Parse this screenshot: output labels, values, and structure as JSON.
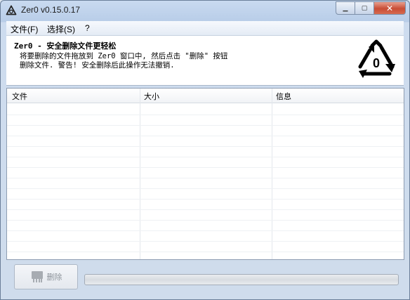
{
  "window": {
    "title": "Zer0 v0.15.0.17",
    "controls": {
      "minimize": "▁",
      "maximize": "▢",
      "close": "✕"
    }
  },
  "menu": [
    {
      "label": "文件(F)"
    },
    {
      "label": "选择(S)"
    },
    {
      "label": "?"
    }
  ],
  "header": {
    "title": "Zer0 - 安全删除文件更轻松",
    "description_line1": "将要删除的文件拖放到 Zer0 窗口中, 然后点击 \"删除\" 按钮",
    "description_line2": "删除文件. 警告! 安全删除后此操作无法撤销.",
    "logo_digit": "0",
    "logo_icon": "recycle-zero-icon"
  },
  "file_list": {
    "columns": [
      "文件",
      "大小",
      "信息"
    ],
    "rows": []
  },
  "footer": {
    "delete_label": "删除",
    "delete_icon": "shredder-icon",
    "progress": 0
  }
}
